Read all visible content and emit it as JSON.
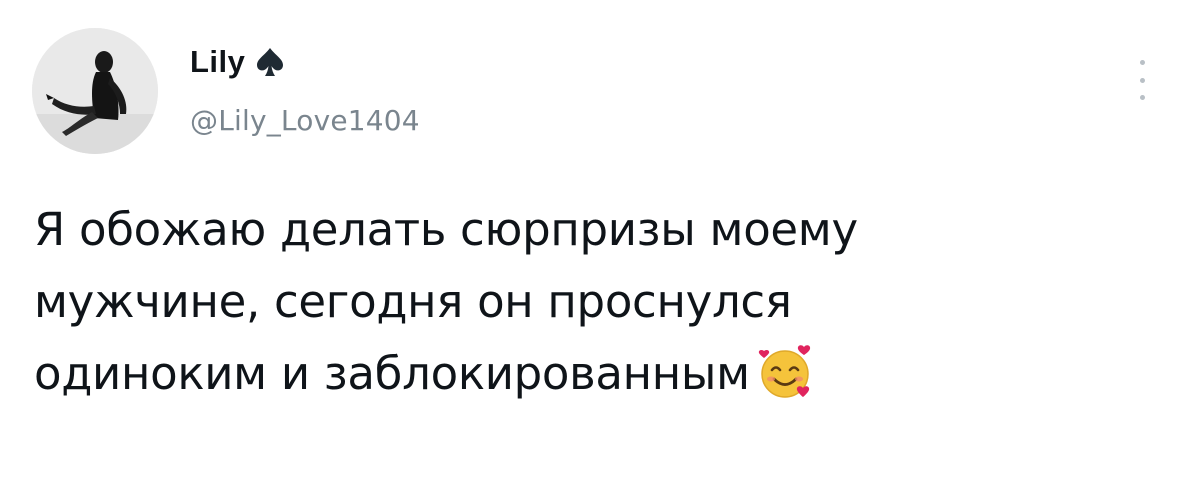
{
  "author": {
    "display_name": "Lily",
    "handle": "@Lily_Love1404",
    "badge_icon": "spade-icon",
    "avatar_icon": "profile-photo"
  },
  "menu": {
    "more_icon": "more-vertical-icon"
  },
  "tweet": {
    "lines": [
      "Я обожаю делать сюрпризы моему",
      "мужчине, сегодня он проснулся",
      "одиноким и заблокированным"
    ],
    "emoji": "smiling-face-with-hearts-icon"
  },
  "colors": {
    "text": "#0f1419",
    "secondary_text": "#7a858e",
    "background": "#ffffff",
    "emoji_face": "#f5c33b",
    "emoji_hearts": "#e0245e"
  }
}
